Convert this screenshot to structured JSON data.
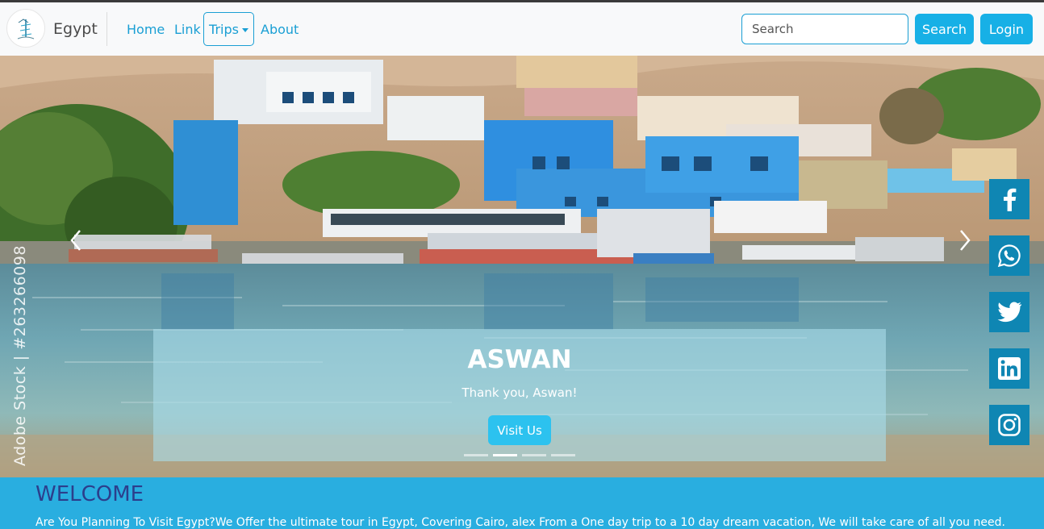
{
  "navbar": {
    "brand": "Egypt",
    "links": {
      "home": "Home",
      "link": "Link",
      "trips": "Trips",
      "about": "About"
    },
    "search_placeholder": "Search",
    "search_button": "Search",
    "login_button": "Login"
  },
  "carousel": {
    "slide_title": "ASWAN",
    "slide_text": "Thank you, Aswan!",
    "visit_button": "Visit Us",
    "watermark": "Adobe Stock | #263266098",
    "indicator_count": 4,
    "active_indicator": 2
  },
  "social": [
    "facebook-icon",
    "whatsapp-icon",
    "twitter-icon",
    "linkedin-icon",
    "instagram-icon"
  ],
  "welcome": {
    "title": "WELCOME",
    "text": "Are You Planning To Visit Egypt?We Offer the ultimate tour in Egypt, Covering Cairo, alex From a One day trip to a 10 day dream vacation, We will take care of all you need."
  },
  "colors": {
    "accent": "#1a9fd4",
    "button": "#17b0e6",
    "social": "#0f86b3",
    "welcome_bg": "#29aee0",
    "welcome_title": "#2c3e8c"
  }
}
